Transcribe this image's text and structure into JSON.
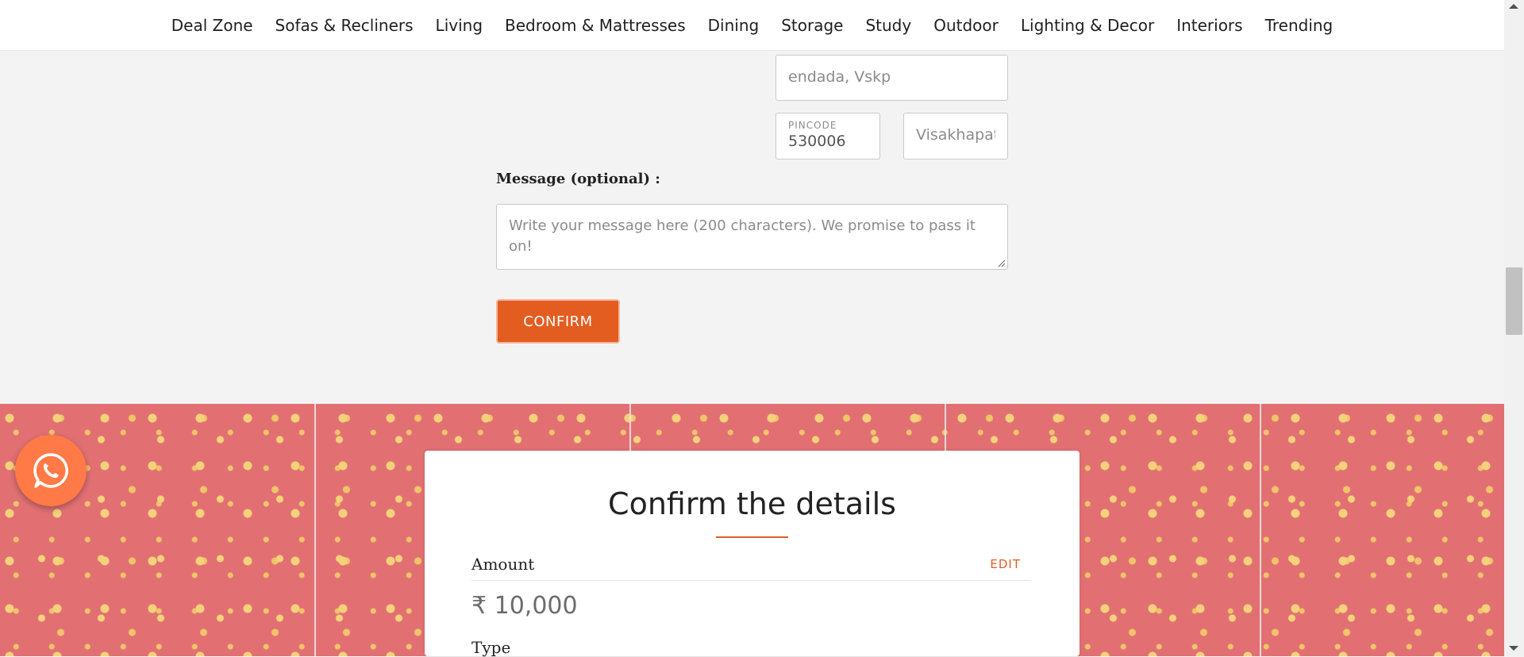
{
  "nav": {
    "items": [
      "Deal Zone",
      "Sofas & Recliners",
      "Living",
      "Bedroom & Mattresses",
      "Dining",
      "Storage",
      "Study",
      "Outdoor",
      "Lighting & Decor",
      "Interiors",
      "Trending"
    ]
  },
  "form": {
    "address_value": "endada, Vskp",
    "pincode_label": "PINCODE",
    "pincode_value": "530006",
    "city_value": "Visakhapatnam",
    "message_label": "Message (optional) :",
    "message_placeholder": "Write your message here (200 characters). We promise to pass it on!",
    "confirm_label": "CONFIRM"
  },
  "details": {
    "title": "Confirm the details",
    "amount_label": "Amount",
    "edit_label": "EDIT",
    "amount_value": "₹ 10,000",
    "type_label": "Type"
  },
  "colors": {
    "accent": "#e35d21",
    "pattern_bg": "#e27073",
    "whatsapp_bg": "#ff7a47"
  },
  "icons": {
    "whatsapp": "whatsapp-icon"
  }
}
